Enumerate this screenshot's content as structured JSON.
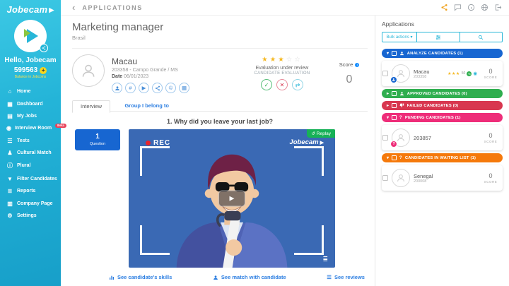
{
  "colors": {
    "accent_teal": "#2ab7d8",
    "group_blue": "#1766d1",
    "group_green": "#2fae4f",
    "group_red": "#d8374f",
    "group_pink": "#ee2d79",
    "group_orange": "#f5790b",
    "video_bg": "#3a69b4",
    "star_gold": "#f5b821",
    "share_orange": "#f0a11c",
    "replay_green": "#17b157",
    "beta_red": "#e8425a"
  },
  "icons": {
    "star_filled": "★",
    "star_empty": "☆",
    "caret_down": "▾",
    "back": "‹",
    "plus": "+",
    "logo_play": "▶",
    "hashtag": "#",
    "play": "▶",
    "copyright": "©",
    "calendar": "▦",
    "check": "✓",
    "cross": "✕",
    "swap": "⇄",
    "replay_arrow": "↺",
    "list_lines": "≣",
    "reviews_list": "☰",
    "question_mark": "?",
    "eye": "◉",
    "percent": "%",
    "info_i": "i"
  },
  "sidebar": {
    "logo": "Jobecam",
    "greeting": "Hello, Jobecam",
    "balance": "599563",
    "balance_label": "Balance in Jobcoins",
    "items": [
      {
        "icon": "⌂",
        "label": "Home"
      },
      {
        "icon": "▦",
        "label": "Dashboard"
      },
      {
        "icon": "▤",
        "label": "My Jobs"
      },
      {
        "icon": "◉",
        "label": "Interview Room",
        "badge": "Beta"
      },
      {
        "icon": "☰",
        "label": "Tests"
      },
      {
        "icon": "♟",
        "label": "Cultural Match"
      },
      {
        "icon": "ⓘ",
        "label": "Plural"
      },
      {
        "icon": "▼",
        "label": "Filter Candidates"
      },
      {
        "icon": "≣",
        "label": "Reports"
      },
      {
        "icon": "▥",
        "label": "Company Page"
      },
      {
        "icon": "⚙",
        "label": "Settings"
      }
    ]
  },
  "topbar": {
    "back": "‹",
    "title": "APPLICATIONS"
  },
  "main": {
    "job_title": "Marketing manager",
    "job_location": "Brasil",
    "candidate": {
      "name": "Macau",
      "meta": "203358 - Campo Grande / MS",
      "date_label": "Date",
      "date": "06/01/2023"
    },
    "evaluation": {
      "status": "Evaluation under review",
      "label": "CANDIDATE EVALUATION"
    },
    "score": {
      "label": "Score",
      "value": "0"
    },
    "tabs": {
      "interview": "Interview",
      "group": "Group I belong to"
    },
    "question": {
      "number": "1",
      "label": "Question",
      "title": "1. Why did you leave your last job?"
    },
    "video": {
      "rec": "REC",
      "watermark": "Jobecam",
      "replay": "Replay"
    },
    "links": {
      "skills": "See candidate's skills",
      "match": "See match with candidate",
      "reviews": "See reviews"
    }
  },
  "apps": {
    "title": "Applications",
    "bulk_actions": "Bulk actions ▾",
    "groups": [
      {
        "caret": "▾",
        "label": "ANALYZE CANDIDATES (1)"
      },
      {
        "caret": "▸",
        "label": "APPROVED CANDIDATES (0)"
      },
      {
        "caret": "▸",
        "label": "FAILED CANDIDATES (0)"
      },
      {
        "caret": "▾",
        "label": "PENDING CANDIDATES (1)"
      },
      {
        "caret": "▾",
        "label": "CANDIDATES IN WAITING LIST (1)"
      }
    ],
    "rows": {
      "macau": {
        "name": "Macau",
        "id": "203358",
        "match": "50",
        "score": "0",
        "score_label": "SCORE"
      },
      "pending": {
        "name": "203857",
        "score": "0",
        "score_label": "SCORE"
      },
      "waiting": {
        "name": "Senegal",
        "id": "200008",
        "score": "0",
        "score_label": "SCORE"
      }
    }
  }
}
